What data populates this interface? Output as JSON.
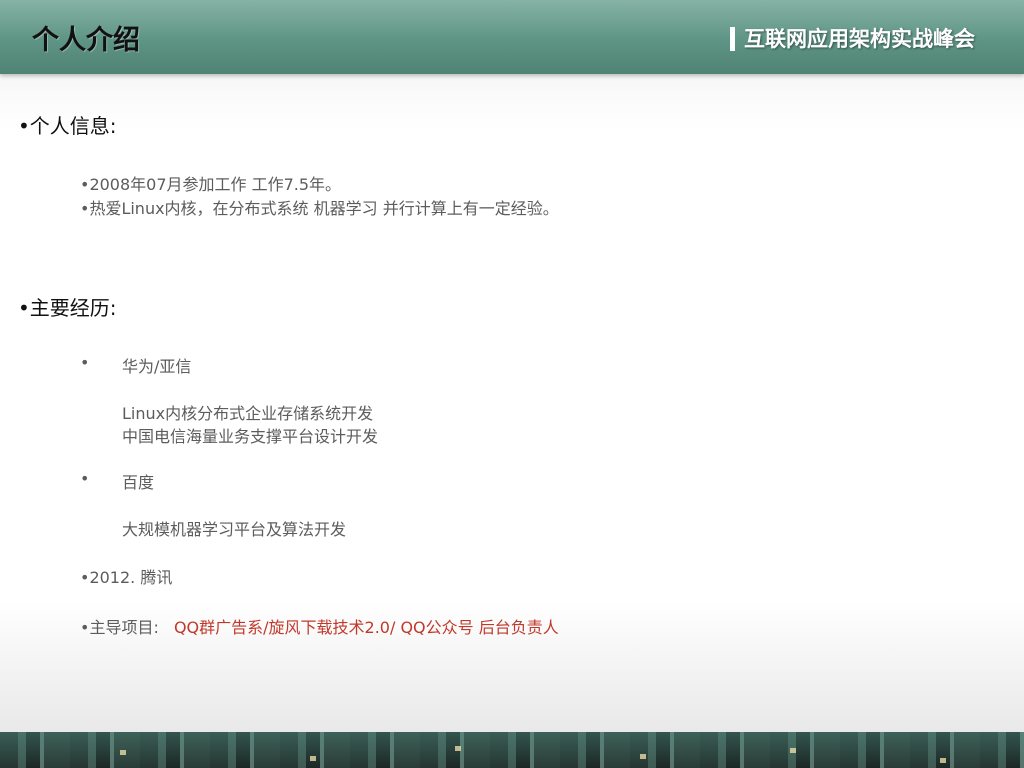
{
  "header": {
    "title": "个人介绍",
    "brand": "互联网应用架构实战峰会"
  },
  "personal_info": {
    "heading": "•个人信息:",
    "items": [
      "•2008年07月参加工作 工作7.5年。",
      "•热爱Linux内核，在分布式系统 机器学习 并行计算上有一定经验。"
    ]
  },
  "experience": {
    "heading": "•主要经历:",
    "bullet": "•",
    "huawei": {
      "company": "华为/亚信",
      "details": [
        "Linux内核分布式企业存储系统开发",
        "中国电信海量业务支撑平台设计开发"
      ]
    },
    "baidu": {
      "company": "百度",
      "details": [
        "大规模机器学习平台及算法开发"
      ]
    },
    "tencent": "•2012. 腾讯",
    "projects": {
      "label": "•主导项目:",
      "value": "QQ群广告系/旋风下载技术2.0/ QQ公众号 后台负责人"
    },
    "colors": {
      "highlight": "#c0392b",
      "body_text": "#5c5c5c"
    }
  }
}
